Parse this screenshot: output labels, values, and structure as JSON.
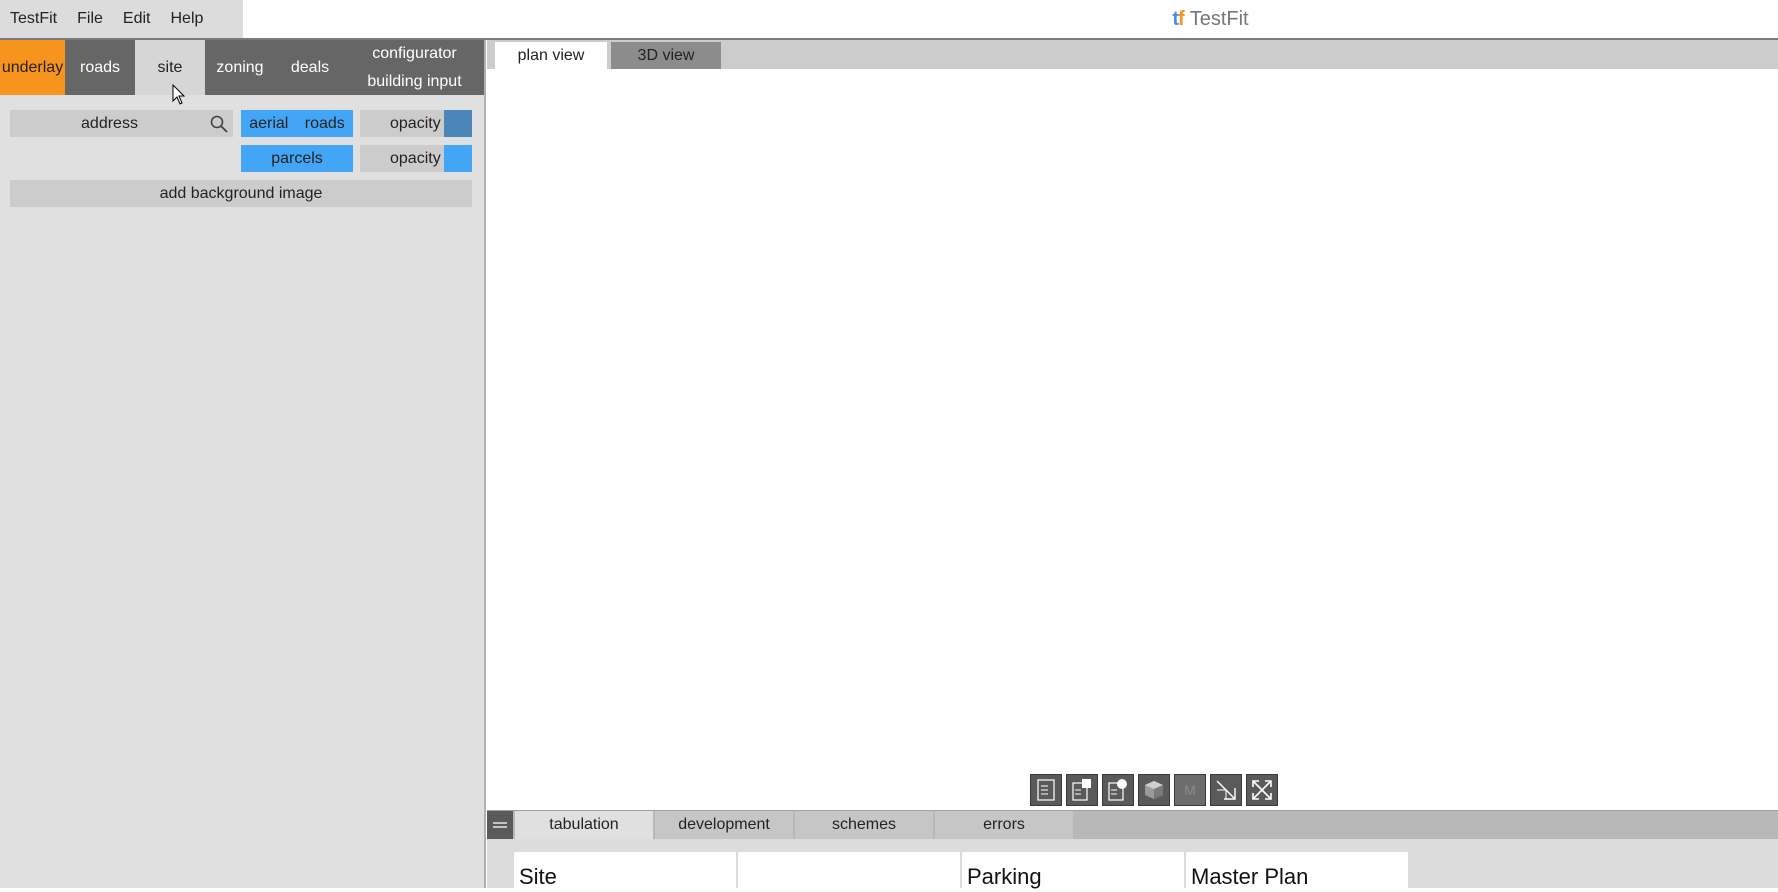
{
  "menu": [
    "TestFit",
    "File",
    "Edit",
    "Help"
  ],
  "brand": {
    "logo_t": "t",
    "logo_f": "f",
    "name": "TestFit"
  },
  "left_tabs": [
    {
      "label": "underlay"
    },
    {
      "label": "roads"
    },
    {
      "label": "site"
    },
    {
      "label": "zoning"
    },
    {
      "label": "deals"
    },
    {
      "line1": "configurator",
      "line2": "building input"
    }
  ],
  "panel": {
    "address_label": "address",
    "aerial_label": "aerial",
    "roads_label": "roads",
    "opacity1_label": "opacity",
    "parcels_label": "parcels",
    "opacity2_label": "opacity",
    "add_bg_label": "add background image",
    "colors": {
      "opacity1_swatch": "#4a86b8",
      "opacity2_swatch": "#42a5f5"
    }
  },
  "view_tabs": [
    "plan view",
    "3D view"
  ],
  "toolbar_icons": [
    "report-icon",
    "report-square-icon",
    "report-circle-icon",
    "cube-icon",
    "m-icon",
    "resize-icon",
    "fullscreen-icon"
  ],
  "toolbar_m_label": "M",
  "bottom_tabs": [
    "tabulation",
    "development",
    "schemes",
    "errors"
  ],
  "tabulation_headers": [
    "Site",
    "",
    "Parking",
    "Master Plan"
  ]
}
